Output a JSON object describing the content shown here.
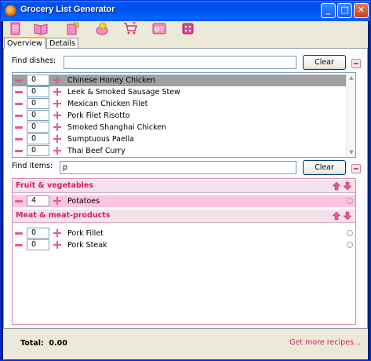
{
  "window": {
    "title": "Grocery List Generator",
    "minimize": "_",
    "maximize": "□",
    "close": "✕"
  },
  "toolbar": {
    "icons": [
      "new-list-icon",
      "recipe-book-icon",
      "edit-recipe-icon",
      "ingredients-icon",
      "cart-icon",
      "options-icon",
      "dice-icon"
    ],
    "options_text": "OT"
  },
  "tabs": [
    {
      "label": "Overview",
      "active": true
    },
    {
      "label": "Details",
      "active": false
    }
  ],
  "dishes": {
    "find_label": "Find dishes:",
    "search_value": "",
    "clear_label": "Clear",
    "items": [
      {
        "qty": "0",
        "name": "Chinese Honey Chicken",
        "selected": true
      },
      {
        "qty": "0",
        "name": "Leek & Smoked Sausage Stew",
        "selected": false
      },
      {
        "qty": "0",
        "name": "Mexican Chicken Filet",
        "selected": false
      },
      {
        "qty": "0",
        "name": "Pork Filet Risotto",
        "selected": false
      },
      {
        "qty": "0",
        "name": "Smoked Shanghai Chicken",
        "selected": false
      },
      {
        "qty": "0",
        "name": "Sumptuous Paella",
        "selected": false
      },
      {
        "qty": "0",
        "name": "Thai Beef Curry",
        "selected": false
      }
    ]
  },
  "items": {
    "find_label": "Find items:",
    "search_value": "p",
    "clear_label": "Clear",
    "categories": [
      {
        "title": "Fruit & vegetables",
        "items": [
          {
            "qty": "4",
            "name": "Potatoes",
            "highlight": true
          }
        ]
      },
      {
        "title": "Meat & meat-products",
        "items": [
          {
            "qty": "0",
            "name": "Pork Fillet",
            "highlight": false
          },
          {
            "qty": "0",
            "name": "Pork Steak",
            "highlight": false
          }
        ]
      }
    ]
  },
  "footer": {
    "total_label": "Total:",
    "total_value": "0.00",
    "more_link": "Get more recipes..."
  },
  "colors": {
    "accent": "#d21e73",
    "selection": "#a0a0a0",
    "highlight_row": "#fbc4e0",
    "category_bg": "#f2e2ea"
  }
}
